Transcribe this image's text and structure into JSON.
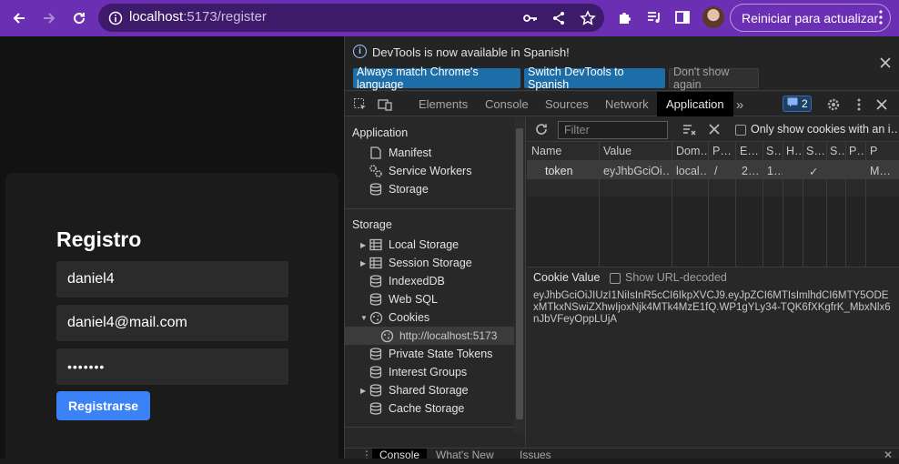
{
  "browser": {
    "url_host": "localhost",
    "url_path": ":5173/register",
    "update_label": "Reiniciar para actualizar"
  },
  "page": {
    "title": "Registro",
    "username": "daniel4",
    "email": "daniel4@mail.com",
    "password": "•••••••",
    "submit_label": "Registrarse",
    "accent": "#3b82f6"
  },
  "devtools": {
    "info_message": "DevTools is now available in Spanish!",
    "btn_match": "Always match Chrome's language",
    "btn_switch": "Switch DevTools to Spanish",
    "btn_dont_show": "Don't show again",
    "tabs": [
      "Elements",
      "Console",
      "Sources",
      "Network",
      "Application"
    ],
    "active_tab": "Application",
    "issues_count": "2",
    "sidebar": {
      "section_application": "Application",
      "app_items": [
        "Manifest",
        "Service Workers",
        "Storage"
      ],
      "section_storage": "Storage",
      "storage_items": [
        "Local Storage",
        "Session Storage",
        "IndexedDB",
        "Web SQL",
        "Cookies"
      ],
      "cookie_origin": "http://localhost:5173",
      "more_items": [
        "Private State Tokens",
        "Interest Groups",
        "Shared Storage",
        "Cache Storage"
      ]
    },
    "filter_placeholder": "Filter",
    "only_cookies_label": "Only show cookies with an i…",
    "columns": [
      "Name",
      "Value",
      "Dom…",
      "P…",
      "E…",
      "S…",
      "H…",
      "S…",
      "S…",
      "P…",
      "P"
    ],
    "cookie_row": {
      "name": "token",
      "value": "eyJhbGciOi…",
      "domain": "local…",
      "path": "/",
      "expires": "2…",
      "size": "1…",
      "http_only": "",
      "secure": "✓",
      "samesite": "",
      "partition": "",
      "priority": "M…"
    },
    "cookie_value_title": "Cookie Value",
    "show_decoded_label": "Show URL-decoded",
    "cookie_value": "eyJhbGciOiJIUzI1NiIsInR5cCI6IkpXVCJ9.eyJpZCI6MTIsImlhdCI6MTY5ODExMTkxNSwiZXhwIjoxNjk4MTk4MzE1fQ.WP1gYLy34-TQK6fXKgfrK_MbxNlx6nJbVFeyOppLUjA",
    "drawer_tabs": [
      "Console",
      "What's New",
      "Issues"
    ]
  }
}
